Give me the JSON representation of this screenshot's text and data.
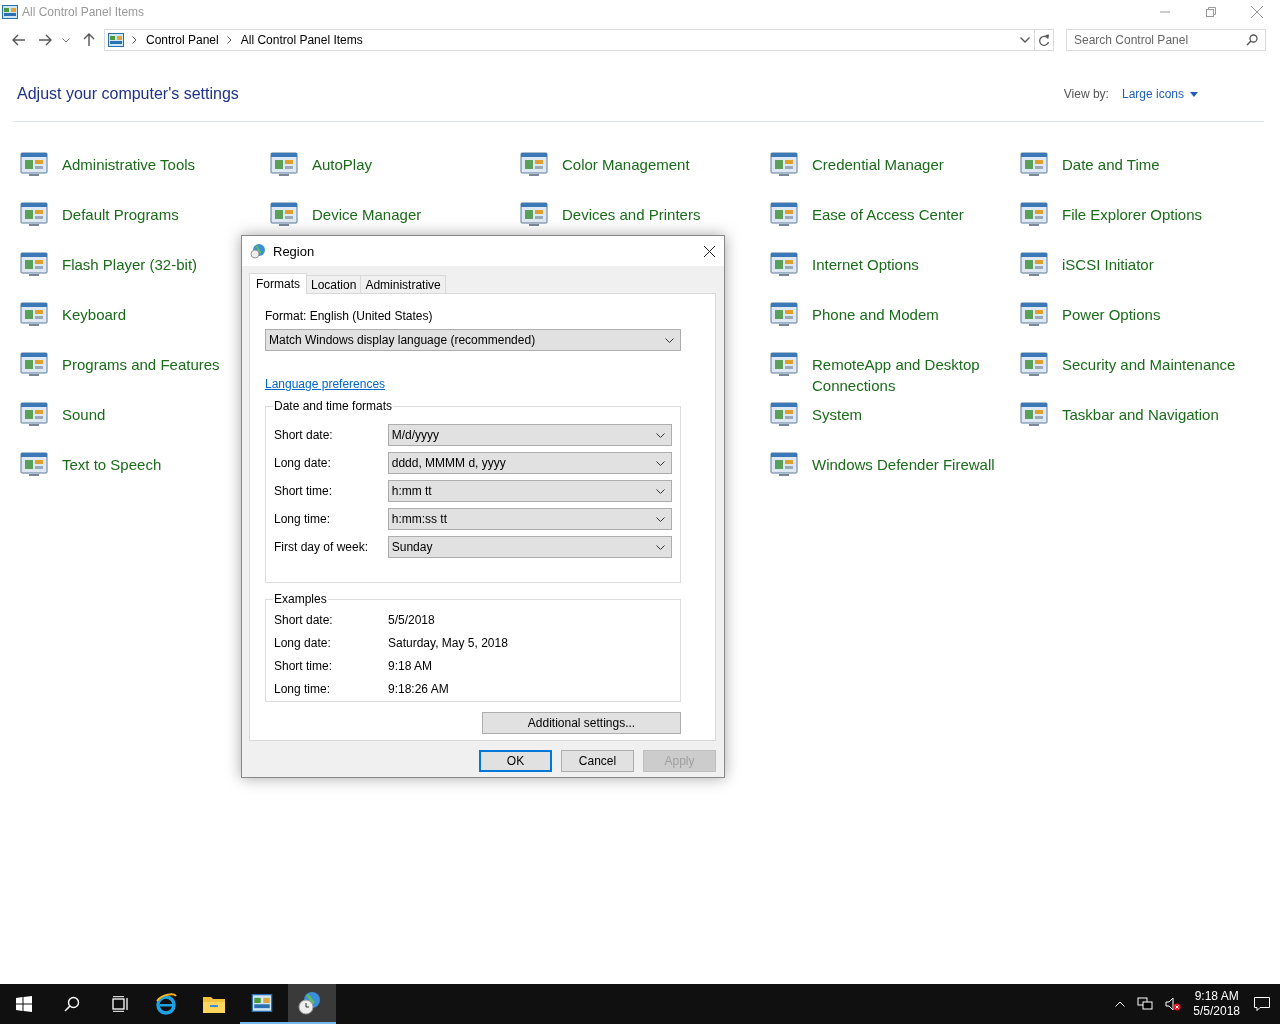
{
  "window": {
    "title": "All Control Panel Items"
  },
  "address_bar": {
    "crumbs": [
      "Control Panel",
      "All Control Panel Items"
    ]
  },
  "search": {
    "placeholder": "Search Control Panel"
  },
  "heading": "Adjust your computer's settings",
  "view_by": {
    "label": "View by:",
    "value": "Large icons"
  },
  "columns": [
    [
      "Administrative Tools",
      "Default Programs",
      "Flash Player (32-bit)",
      "Keyboard",
      "Programs and Features",
      "Sound",
      "Text to Speech"
    ],
    [
      "AutoPlay",
      "Device Manager"
    ],
    [
      "Color Management",
      "Devices and Printers"
    ],
    [
      "Credential Manager",
      "Ease of Access Center",
      "Internet Options",
      "Phone and Modem",
      "RemoteApp and Desktop Connections",
      "System",
      "Windows Defender Firewall"
    ],
    [
      "Date and Time",
      "File Explorer Options",
      "iSCSI Initiator",
      "Power Options",
      "Security and Maintenance",
      "Taskbar and Navigation"
    ]
  ],
  "dialog": {
    "title": "Region",
    "tabs": [
      {
        "label": "Formats",
        "selected": true
      },
      {
        "label": "Location",
        "selected": false
      },
      {
        "label": "Administrative",
        "selected": false
      }
    ],
    "format_label": "Format: English (United States)",
    "format_value": "Match Windows display language (recommended)",
    "link": "Language preferences",
    "formats_group": {
      "title": "Date and time formats",
      "rows": [
        {
          "label": "Short date:",
          "value": "M/d/yyyy"
        },
        {
          "label": "Long date:",
          "value": "dddd, MMMM d, yyyy"
        },
        {
          "label": "Short time:",
          "value": "h:mm tt"
        },
        {
          "label": "Long time:",
          "value": "h:mm:ss tt"
        },
        {
          "label": "First day of week:",
          "value": "Sunday"
        }
      ]
    },
    "examples_group": {
      "title": "Examples",
      "rows": [
        {
          "label": "Short date:",
          "value": "5/5/2018"
        },
        {
          "label": "Long date:",
          "value": "Saturday, May 5, 2018"
        },
        {
          "label": "Short time:",
          "value": "9:18 AM"
        },
        {
          "label": "Long time:",
          "value": "9:18:26 AM"
        }
      ]
    },
    "additional_button": "Additional settings...",
    "buttons": [
      {
        "label": "OK",
        "default": true,
        "disabled": false
      },
      {
        "label": "Cancel",
        "default": false,
        "disabled": false
      },
      {
        "label": "Apply",
        "default": false,
        "disabled": true
      }
    ]
  },
  "taskbar": {
    "apps": [
      {
        "kind": "browser",
        "running": false,
        "selected": false
      },
      {
        "kind": "folder",
        "running": false,
        "selected": false
      },
      {
        "kind": "control-panel",
        "running": true,
        "selected": false
      },
      {
        "kind": "region",
        "running": true,
        "selected": true
      }
    ],
    "time": "9:18 AM",
    "date": "5/5/2018"
  }
}
